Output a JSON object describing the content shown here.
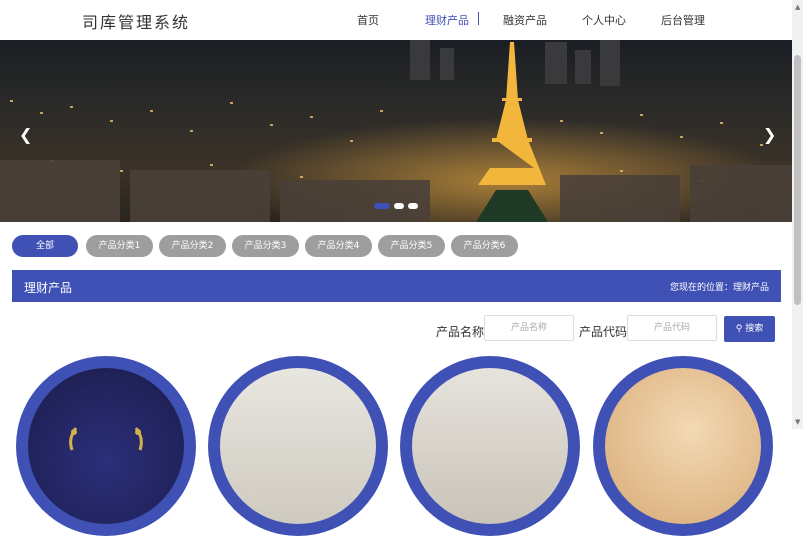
{
  "header": {
    "logo": "司库管理系统",
    "nav": [
      "首页",
      "理财产品",
      "融资产品",
      "个人中心",
      "后台管理"
    ],
    "active_nav": 1
  },
  "banner": {
    "prev_icon": "chevron-left-icon",
    "next_icon": "chevron-right-icon",
    "slide_count": 3,
    "active_slide": 0
  },
  "categories": [
    "全部",
    "产品分类1",
    "产品分类2",
    "产品分类3",
    "产品分类4",
    "产品分类5",
    "产品分类6"
  ],
  "section": {
    "title": "理财产品",
    "breadcrumb": "您现在的位置：理财产品"
  },
  "search": {
    "name_label": "产品名称",
    "name_placeholder": "产品名称",
    "code_label": "产品代码",
    "code_placeholder": "产品代码",
    "button_label": "搜索"
  },
  "colors": {
    "accent": "#3f51b5",
    "pill_inactive": "#9e9e9e"
  }
}
